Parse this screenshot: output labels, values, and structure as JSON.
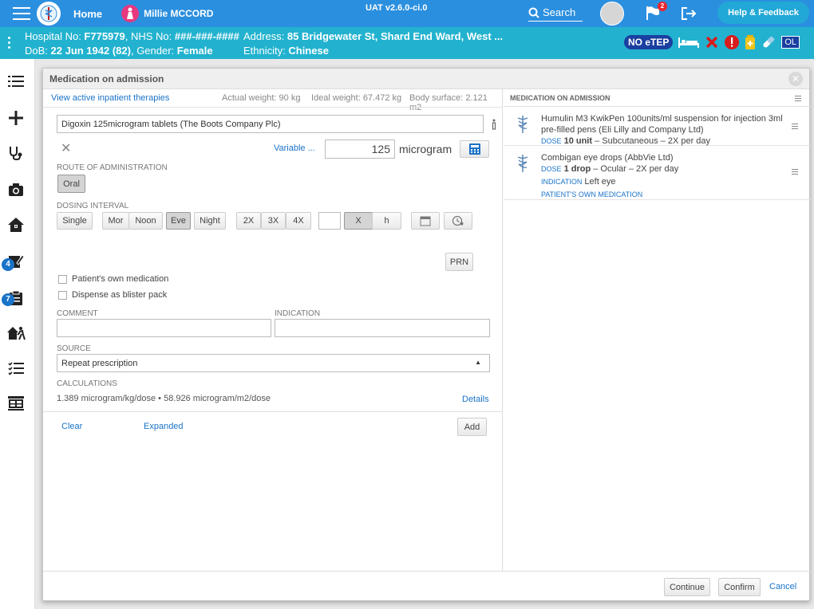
{
  "topbar": {
    "home_label": "Home",
    "patient_name": "Millie MCCORD",
    "version": "UAT v2.6.0-ci.0",
    "search_label": "Search",
    "notification_count": "2",
    "help_label": "Help & Feedback",
    "accent": "#2b8fdf"
  },
  "banner": {
    "line1_prefix": "Hospital No: ",
    "hospital_no": "F775979",
    "nhs_prefix": ", NHS No: ",
    "nhs_no": "###-###-####",
    "line2_prefix": "DoB: ",
    "dob": "22 Jun 1942 (82)",
    "gender_prefix": ", Gender: ",
    "gender": "Female",
    "address_prefix": "Address: ",
    "address": "85 Bridgewater St, Shard End Ward, West ...",
    "ethnicity_prefix": "Ethnicity: ",
    "ethnicity": "Chinese",
    "netep_label": "NO eTEP",
    "ol_label": "OL",
    "color": "#22b2cf"
  },
  "leftnav": {
    "badge_1": "4",
    "badge_2": "7"
  },
  "modal": {
    "title": "Medication on admission",
    "view_active_link": "View active inpatient therapies",
    "actual_weight": "Actual weight: 90 kg",
    "ideal_weight": "Ideal weight: 67.472 kg",
    "body_surface": "Body surface: 2.121 m2",
    "drug_value": "Digoxin 125microgram tablets (The Boots Company Plc)",
    "variable_link": "Variable ...",
    "dose_value": "125",
    "dose_unit": "microgram",
    "route_label": "ROUTE OF ADMINISTRATION",
    "route_oral": "Oral",
    "dosing_label": "DOSING INTERVAL",
    "dosing": {
      "single": "Single",
      "mor": "Mor",
      "noon": "Noon",
      "eve": "Eve",
      "night": "Night",
      "x2": "2X",
      "x3": "3X",
      "x4": "4X",
      "x": "X",
      "h": "h"
    },
    "prn_label": "PRN",
    "patients_own_label": "Patient's own medication",
    "blister_label": "Dispense as blister pack",
    "comment_label": "COMMENT",
    "indication_label": "INDICATION",
    "source_label": "SOURCE",
    "source_value": "Repeat prescription",
    "calculations_label": "CALCULATIONS",
    "calculations_value": "1.389 microgram/kg/dose • 58.926 microgram/m2/dose",
    "details_link": "Details",
    "clear_link": "Clear",
    "expanded_link": "Expanded",
    "add_button": "Add",
    "continue_button": "Continue",
    "confirm_button": "Confirm",
    "cancel_link": "Cancel"
  },
  "admission_list": {
    "title": "MEDICATION ON ADMISSION",
    "items": [
      {
        "name_line1": "Humulin M3 KwikPen 100units/ml suspension for injection 3ml",
        "name_line2": "pre-filled pens (Eli Lilly and Company Ltd)",
        "dose_key": "DOSE",
        "dose_value": "10 unit",
        "dose_rest": " – Subcutaneous – 2X per day"
      },
      {
        "name_line1": "Combigan eye drops (AbbVie Ltd)",
        "dose_key": "DOSE",
        "dose_value": "1 drop",
        "dose_rest": " – Ocular – 2X per day",
        "indication_key": "INDICATION",
        "indication_value": "Left eye",
        "own_label": "PATIENT'S OWN MEDICATION"
      }
    ]
  }
}
